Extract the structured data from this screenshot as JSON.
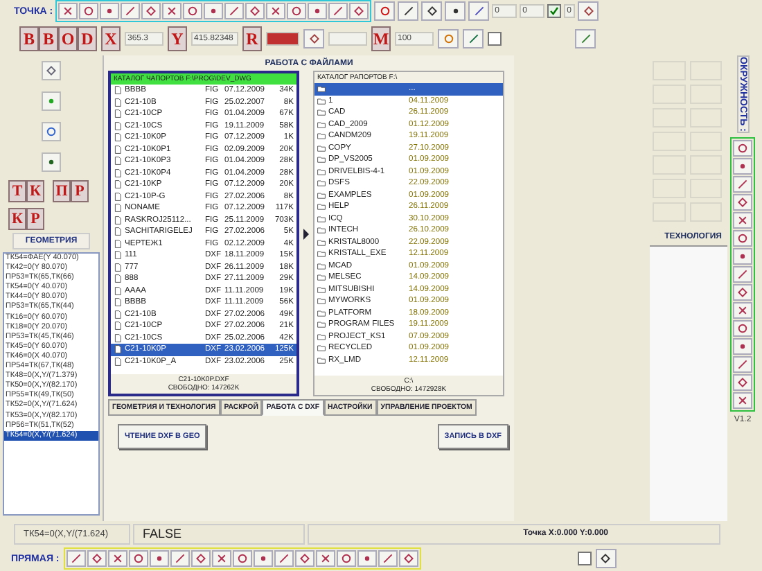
{
  "top_toolbar": {
    "label": "ТОЧКА :",
    "field_1": {
      "value": "0"
    },
    "field_2": {
      "value": "0"
    },
    "checkbox": {
      "checked": true
    },
    "field_3": {
      "value": "0"
    }
  },
  "coord_bar": {
    "letter_buttons": [
      "B",
      "B",
      "O",
      "D"
    ],
    "x": {
      "label": "X",
      "value": "365.3"
    },
    "y": {
      "label": "Y",
      "value": "415.82348"
    },
    "r": {
      "label": "R"
    },
    "m": {
      "label": "M",
      "value": "100"
    },
    "checkbox": {
      "checked": false
    }
  },
  "side_panel": {
    "letter_groups": [
      [
        "Т",
        "К"
      ],
      [
        "П",
        "Р"
      ],
      [
        "К",
        "Р"
      ]
    ],
    "title": "ГЕОМЕТРИЯ",
    "items": [
      {
        "text": "ТК54=ФАЕ(Y 40.070)",
        "selected": false
      },
      {
        "text": "ТК42=0(Y 80.070)",
        "selected": false
      },
      {
        "text": "ПР53=ТК(65,ТК(66)",
        "selected": false
      },
      {
        "text": "ТК54=0(Y 40.070)",
        "selected": false
      },
      {
        "text": "ТК44=0(Y 80.070)",
        "selected": false
      },
      {
        "text": "ПР53=ТК(65,ТК(44)",
        "selected": false
      },
      {
        "text": "ТК16=0(Y 60.070)",
        "selected": false
      },
      {
        "text": "ТК18=0(Y 20.070)",
        "selected": false
      },
      {
        "text": "ПР53=ТК(45,ТК(46)",
        "selected": false
      },
      {
        "text": "ТК45=0(Y 60.070)",
        "selected": false
      },
      {
        "text": "ТК46=0(X 40.070)",
        "selected": false
      },
      {
        "text": "ПР54=ТК(67,ТК(48)",
        "selected": false
      },
      {
        "text": "ТК48=0(X,Y/(71.379)",
        "selected": false
      },
      {
        "text": "ТК50=0(X,Y/(82.170)",
        "selected": false
      },
      {
        "text": "ПР55=ТК(49,ТК(50)",
        "selected": false
      },
      {
        "text": "ТК52=0(X,Y/(71.624)",
        "selected": false
      },
      {
        "text": "ТК53=0(X,Y/(82.170)",
        "selected": false
      },
      {
        "text": "ПР56=ТК(51,ТК(52)",
        "selected": false
      },
      {
        "text": "ТК54=0(X,Y/(71.624)",
        "selected": true
      }
    ]
  },
  "file_panel": {
    "title": "РАБОТА С ФАЙЛАМИ",
    "source": {
      "header": "КАТАЛОГ ЧАПОРТОВ F:\\PROG\\DEV_DWG",
      "files": [
        {
          "name": "BBBB",
          "type": "FIG",
          "date": "07.12.2009",
          "size": "34K",
          "selected": false
        },
        {
          "name": "C21-10B",
          "type": "FIG",
          "date": "25.02.2007",
          "size": "8K",
          "selected": false
        },
        {
          "name": "C21-10CP",
          "type": "FIG",
          "date": "01.04.2009",
          "size": "67K",
          "selected": false
        },
        {
          "name": "C21-10CS",
          "type": "FIG",
          "date": "19.11.2009",
          "size": "58K",
          "selected": false
        },
        {
          "name": "C21-10K0P",
          "type": "FIG",
          "date": "07.12.2009",
          "size": "1K",
          "selected": false
        },
        {
          "name": "C21-10K0P1",
          "type": "FIG",
          "date": "02.09.2009",
          "size": "20K",
          "selected": false
        },
        {
          "name": "C21-10K0P3",
          "type": "FIG",
          "date": "01.04.2009",
          "size": "28K",
          "selected": false
        },
        {
          "name": "C21-10K0P4",
          "type": "FIG",
          "date": "01.04.2009",
          "size": "28K",
          "selected": false
        },
        {
          "name": "C21-10KP",
          "type": "FIG",
          "date": "07.12.2009",
          "size": "20K",
          "selected": false
        },
        {
          "name": "C21-10P-G",
          "type": "FIG",
          "date": "27.02.2006",
          "size": "8K",
          "selected": false
        },
        {
          "name": "NONAME",
          "type": "FIG",
          "date": "07.12.2009",
          "size": "117K",
          "selected": false
        },
        {
          "name": "RASKROJ25112...",
          "type": "FIG",
          "date": "25.11.2009",
          "size": "703K",
          "selected": false
        },
        {
          "name": "SACHITARIGELEJ",
          "type": "FIG",
          "date": "27.02.2006",
          "size": "5K",
          "selected": false
        },
        {
          "name": "ЧЕРТЕЖ1",
          "type": "FIG",
          "date": "02.12.2009",
          "size": "4K",
          "selected": false
        },
        {
          "name": "111",
          "type": "DXF",
          "date": "18.11.2009",
          "size": "15K",
          "selected": false
        },
        {
          "name": "777",
          "type": "DXF",
          "date": "26.11.2009",
          "size": "18K",
          "selected": false
        },
        {
          "name": "888",
          "type": "DXF",
          "date": "27.11.2009",
          "size": "29K",
          "selected": false
        },
        {
          "name": "AAAA",
          "type": "DXF",
          "date": "11.11.2009",
          "size": "19K",
          "selected": false
        },
        {
          "name": "BBBB",
          "type": "DXF",
          "date": "11.11.2009",
          "size": "56K",
          "selected": false
        },
        {
          "name": "C21-10B",
          "type": "DXF",
          "date": "27.02.2006",
          "size": "49K",
          "selected": false
        },
        {
          "name": "C21-10CP",
          "type": "DXF",
          "date": "27.02.2006",
          "size": "21K",
          "selected": false
        },
        {
          "name": "C21-10CS",
          "type": "DXF",
          "date": "25.02.2006",
          "size": "42K",
          "selected": false
        },
        {
          "name": "C21-10K0P",
          "type": "DXF",
          "date": "23.02.2006",
          "size": "125K",
          "selected": true
        },
        {
          "name": "C21-10K0P_A",
          "type": "DXF",
          "date": "23.02.2006",
          "size": "25K",
          "selected": false
        }
      ],
      "footer": [
        "C21-10K0P.DXF",
        "СВОБОДНО: 147262K"
      ]
    },
    "target": {
      "header": "КАТАЛОГ РАПОРТОВ F:\\",
      "folders": [
        {
          "date": "...",
          "selected": true
        },
        {
          "name": "1",
          "date": "04.11.2009",
          "selected": false
        },
        {
          "name": "CAD",
          "date": "26.11.2009",
          "selected": false
        },
        {
          "name": "CAD_2009",
          "date": "01.12.2009",
          "selected": false
        },
        {
          "name": "CANDM209",
          "date": "19.11.2009",
          "selected": false
        },
        {
          "name": "COPY",
          "date": "27.10.2009",
          "selected": false
        },
        {
          "name": "DP_VS2005",
          "date": "01.09.2009",
          "selected": false
        },
        {
          "name": "DRIVELBIS-4-1",
          "date": "01.09.2009",
          "selected": false
        },
        {
          "name": "DSFS",
          "date": "22.09.2009",
          "selected": false
        },
        {
          "name": "EXAMPLES",
          "date": "01.09.2009",
          "selected": false
        },
        {
          "name": "HELP",
          "date": "26.11.2009",
          "selected": false
        },
        {
          "name": "ICQ",
          "date": "30.10.2009",
          "selected": false
        },
        {
          "name": "INTECH",
          "date": "26.10.2009",
          "selected": false
        },
        {
          "name": "KRISTAL8000",
          "date": "22.09.2009",
          "selected": false
        },
        {
          "name": "KRISTALL_EXE",
          "date": "12.11.2009",
          "selected": false
        },
        {
          "name": "MCAD",
          "date": "01.09.2009",
          "selected": false
        },
        {
          "name": "MELSEC",
          "date": "14.09.2009",
          "selected": false
        },
        {
          "name": "MITSUBISHI",
          "date": "14.09.2009",
          "selected": false
        },
        {
          "name": "MYWORKS",
          "date": "01.09.2009",
          "selected": false
        },
        {
          "name": "PLATFORM",
          "date": "18.09.2009",
          "selected": false
        },
        {
          "name": "PROGRAM FILES",
          "date": "19.11.2009",
          "selected": false
        },
        {
          "name": "PROJECT_KS1",
          "date": "07.09.2009",
          "selected": false
        },
        {
          "name": "RECYCLED",
          "date": "01.09.2009",
          "selected": false
        },
        {
          "name": "RX_LMD",
          "date": "12.11.2009",
          "selected": false
        }
      ],
      "footer": [
        "C:\\",
        "СВОБОДНО: 1472928K"
      ]
    }
  },
  "tabs": [
    {
      "label": "ГЕОМЕТРИЯ И ТЕХНОЛОГИЯ",
      "selected": false
    },
    {
      "label": "РАСКРОЙ",
      "selected": false
    },
    {
      "label": "РАБОТА С DXF",
      "selected": true
    },
    {
      "label": "НАСТРОЙКИ",
      "selected": false
    },
    {
      "label": "УПРАВЛЕНИЕ ПРОЕКТОМ",
      "selected": false
    }
  ],
  "buttons": {
    "read": "ЧТЕНИЕ DXF В GEO",
    "write": "ЗАПИСЬ В DXF"
  },
  "right_panel": {
    "vertical_tab": "ОКРУЖНОСТЬ :",
    "technology": "ТЕХНОЛОГИЯ",
    "version": "V1.2"
  },
  "status_bar": {
    "cell_1": "ТК54=0(X,Y/(71.624)",
    "cell_2": "FALSE",
    "cell_3": "Точка X:0.000 Y:0.000"
  },
  "bottom_toolbar": {
    "label": "ПРЯМАЯ :",
    "checkbox": {
      "checked": false
    }
  }
}
